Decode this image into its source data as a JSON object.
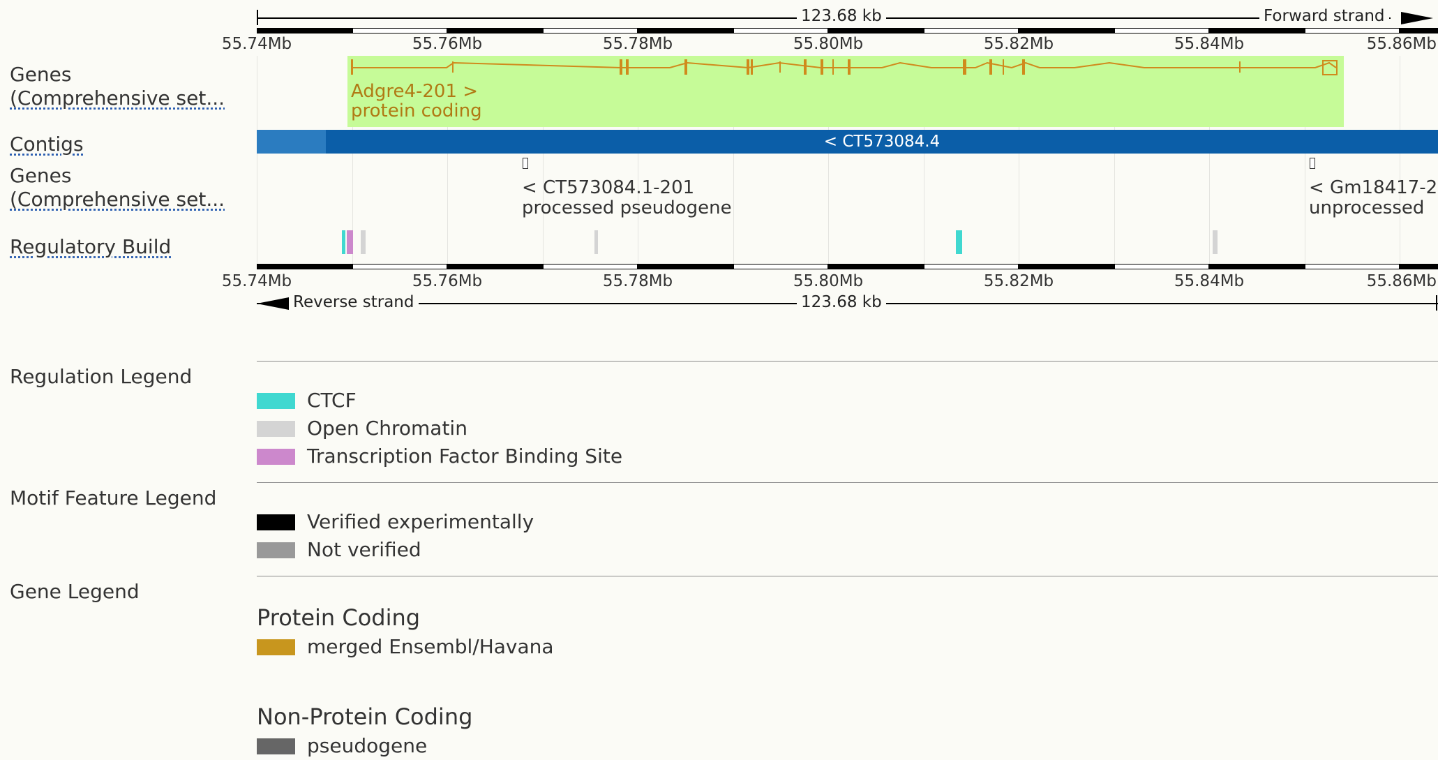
{
  "colors": {
    "background": "#fbfbf6",
    "gene_box": "#c6fb98",
    "gene_line": "#d08a1c",
    "contig_dark": "#0b5ea8",
    "contig_light": "#2b7cc0",
    "ctcf": "#40d8d0",
    "open_chromatin": "#d4d4d4",
    "tfbs": "#cc88cc",
    "verified": "#000000",
    "not_verified": "#999999",
    "merged": "#c8961e",
    "pseudogene": "#666666"
  },
  "ruler_top": {
    "span": "123.68 kb",
    "strand": "Forward strand"
  },
  "ruler_bottom": {
    "span": "123.68 kb",
    "strand": "Reverse strand"
  },
  "ticks": [
    "55.74Mb",
    "55.76Mb",
    "55.78Mb",
    "55.80Mb",
    "55.82Mb",
    "55.84Mb",
    "55.86Mb"
  ],
  "tracks": {
    "genes_top": {
      "line1": "Genes",
      "line2": "(Comprehensive set..."
    },
    "contigs": "Contigs",
    "genes_bottom": {
      "line1": "Genes",
      "line2": "(Comprehensive set..."
    },
    "regulatory": "Regulatory Build"
  },
  "gene_top": {
    "name": "Adgre4-201 >",
    "biotype": "protein coding"
  },
  "contig": {
    "label": "< CT573084.4"
  },
  "gene_bottom_1": {
    "name": "< CT573084.1-201",
    "biotype": "processed pseudogene"
  },
  "gene_bottom_2": {
    "name": "< Gm18417-2",
    "biotype": "unprocessed"
  },
  "legends": {
    "regulation": {
      "heading": "Regulation Legend",
      "items": [
        {
          "label": "CTCF",
          "color": "#40d8d0"
        },
        {
          "label": "Open Chromatin",
          "color": "#d4d4d4"
        },
        {
          "label": "Transcription Factor Binding Site",
          "color": "#cc88cc"
        }
      ]
    },
    "motif": {
      "heading": "Motif Feature Legend",
      "items": [
        {
          "label": "Verified experimentally",
          "color": "#000000"
        },
        {
          "label": "Not verified",
          "color": "#999999"
        }
      ]
    },
    "gene": {
      "heading": "Gene Legend",
      "groups": [
        {
          "title": "Protein Coding",
          "item": "merged Ensembl/Havana",
          "color": "#c8961e"
        },
        {
          "title": "Non-Protein Coding",
          "item": "pseudogene",
          "color": "#666666"
        }
      ]
    }
  }
}
